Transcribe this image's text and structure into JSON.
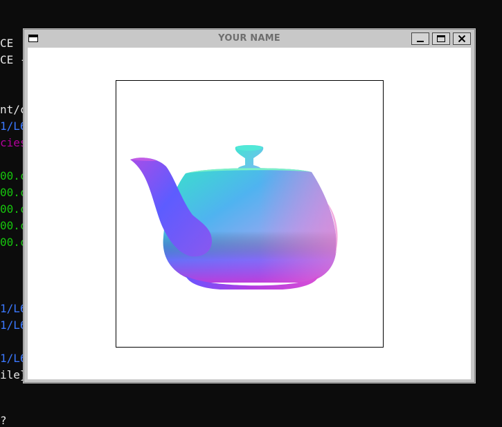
{
  "window": {
    "title": "YOUR NAME"
  },
  "terminal_fragments": [
    {
      "text": "CE",
      "color": "white"
    },
    {
      "text": "CE -",
      "color": "white"
    },
    {
      "text": "nt/c",
      "color": "white"
    },
    {
      "text": "1/L6",
      "color": "blue"
    },
    {
      "text": "cies",
      "color": "magenta"
    },
    {
      "text": "00.c",
      "color": "green"
    },
    {
      "text": "00.c",
      "color": "green"
    },
    {
      "text": "00.c",
      "color": "green"
    },
    {
      "text": "00.c",
      "color": "green"
    },
    {
      "text": "00.c",
      "color": "green"
    },
    {
      "text": "1/L6",
      "color": "blue"
    },
    {
      "text": "1/L6",
      "color": "blue"
    },
    {
      "text": "1/L6",
      "color": "blue"
    },
    {
      "text": "ile}",
      "color": "white"
    },
    {
      "text": "?",
      "color": "white"
    }
  ],
  "colors": {
    "terminal_bg": "#0c0c0c",
    "window_frame": "#c8c8c8",
    "client_bg": "#ffffff",
    "teapot_cyan": "#3fe6d9",
    "teapot_blue": "#5a6cff",
    "teapot_magenta": "#e23bd9",
    "teapot_pink": "#e8a7d8"
  },
  "icons": {
    "system_menu": "window-menu-icon",
    "minimize": "minimize-icon",
    "maximize": "maximize-icon",
    "close": "close-icon"
  }
}
